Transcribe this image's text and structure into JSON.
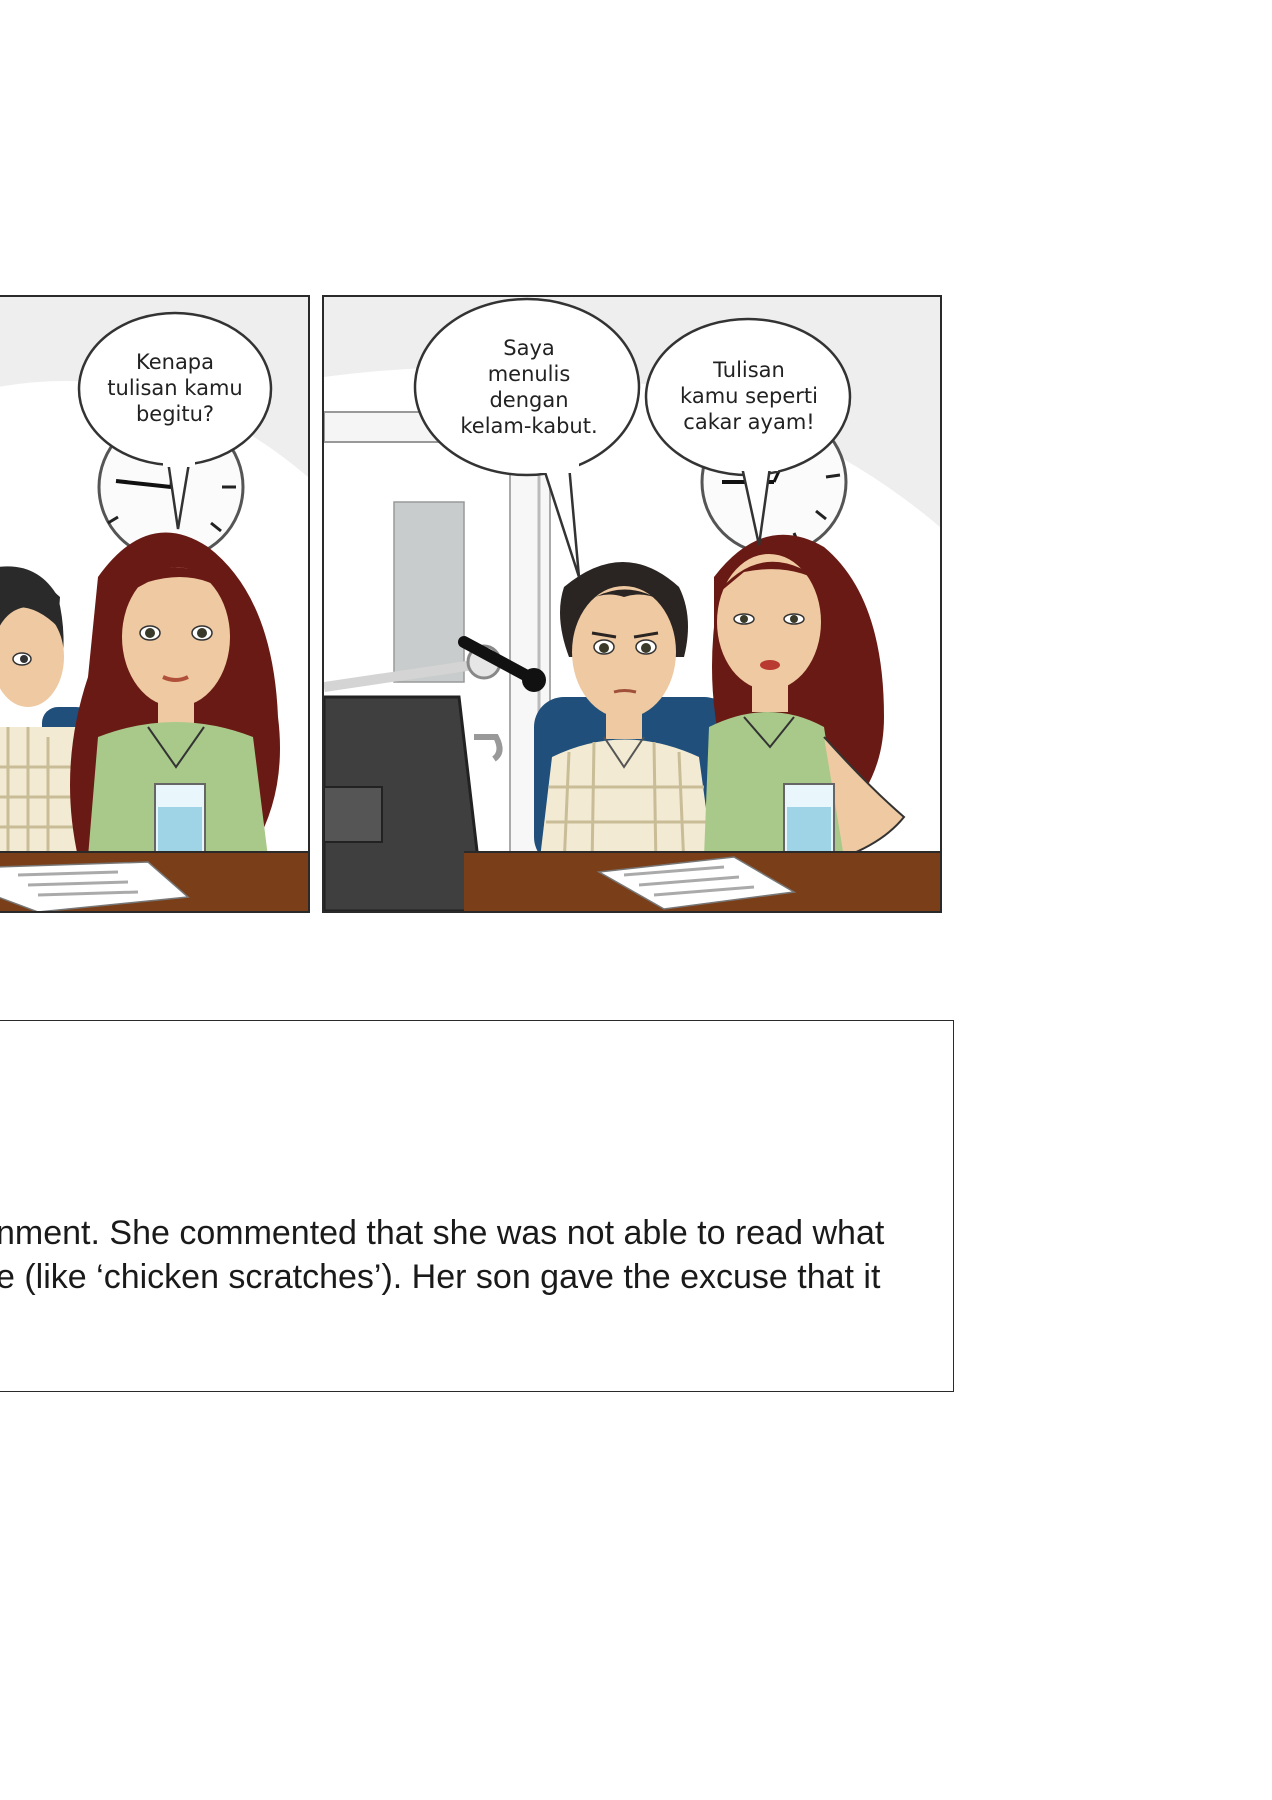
{
  "panels": [
    {
      "bubbles": [
        {
          "lines": [
            "Kenapa",
            "tulisan kamu",
            "begitu?"
          ]
        }
      ]
    },
    {
      "bubbles": [
        {
          "lines": [
            "Saya",
            "menulis",
            "dengan",
            "kelam-kabut."
          ]
        },
        {
          "lines": [
            "Tulisan",
            "kamu seperti",
            "cakar ayam!"
          ]
        }
      ]
    }
  ],
  "caption": {
    "lines": [
      "nment. She commented that she was not able to read what",
      "e (like ‘chicken scratches’). Her son gave the excuse that it"
    ]
  }
}
